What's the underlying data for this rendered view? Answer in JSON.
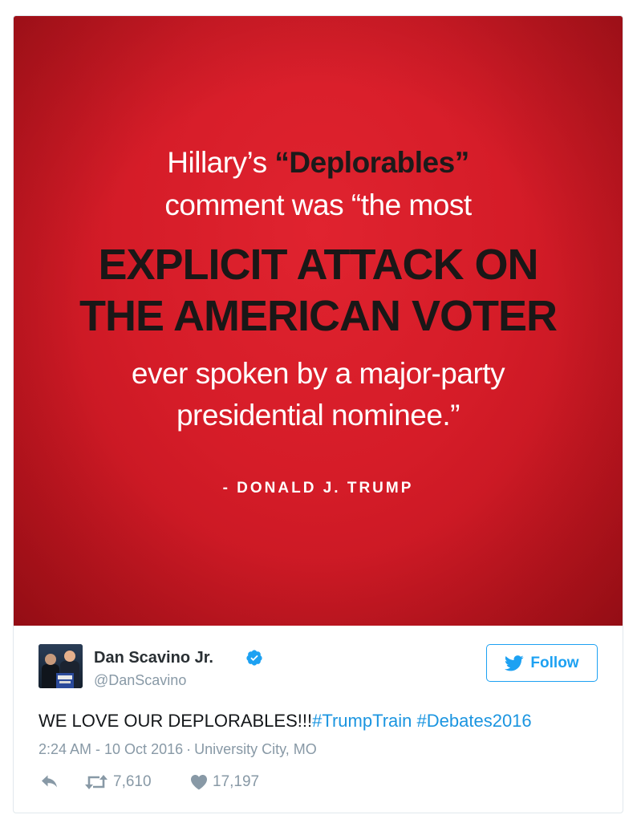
{
  "quote": {
    "line1_a": "Hillary’s ",
    "line1_b": "“Deplorables”",
    "line2": "comment was “the most",
    "line3": "EXPLICIT ATTACK ON",
    "line4": "THE AMERICAN VOTER",
    "line5": "ever spoken by a major-party",
    "line6": "presidential nominee.”",
    "attribution": "- DONALD J. TRUMP"
  },
  "author": {
    "name": "Dan Scavino Jr.",
    "handle": "@DanScavino",
    "verified": true
  },
  "follow": {
    "label": "Follow"
  },
  "tweet": {
    "text": "WE LOVE OUR DEPLORABLES!!!",
    "hashtag1": "#TrumpTrain",
    "hashtag2": "#Debates2016",
    "time": "2:24 AM - 10 Oct 2016",
    "separator": "·",
    "location": "University City, MO"
  },
  "stats": {
    "retweets": "7,610",
    "likes": "17,197"
  },
  "colors": {
    "accent": "#1da1f2",
    "hashtag": "#1b95e0",
    "muted": "#8899a6",
    "quote_bg": "#d51c28"
  },
  "icons": {
    "verified": "verified-badge-icon",
    "follow": "twitter-bird-icon",
    "reply": "reply-icon",
    "retweet": "retweet-icon",
    "like": "heart-icon"
  }
}
